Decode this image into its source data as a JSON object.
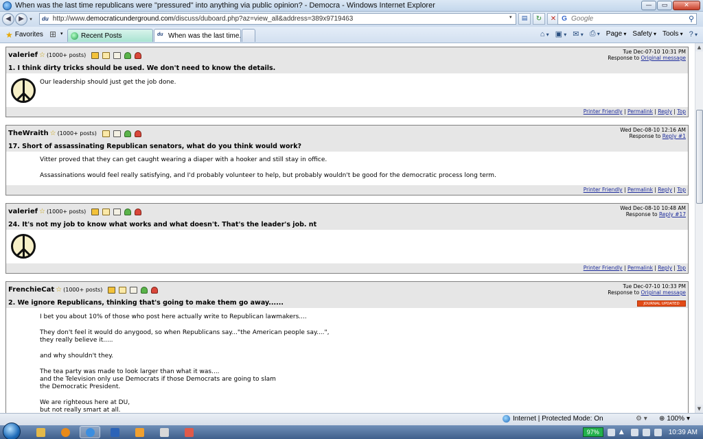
{
  "window": {
    "title": "When was the last time republicans were \"pressured\" into anything via public opinion? - Democra - Windows Internet Explorer"
  },
  "address_bar": {
    "url_prefix": "http://www.",
    "url_domain": "democraticunderground.com",
    "url_path": "/discuss/duboard.php?az=view_all&address=389x9719463"
  },
  "search": {
    "placeholder": "Google"
  },
  "favorites_bar": {
    "favorites_label": "Favorites",
    "tabs": [
      {
        "label": "Recent Posts"
      },
      {
        "label": "When was the last time..."
      }
    ]
  },
  "command_bar": {
    "page_label": "Page",
    "safety_label": "Safety",
    "tools_label": "Tools"
  },
  "posts": [
    {
      "author": "valerief",
      "post_count": "(1000+ posts)",
      "date": "Tue Dec-07-10 10:31 PM",
      "response_prefix": "Response to",
      "response_link": "Original message",
      "subject": "1. I think dirty tricks should be used. We don't need to know the details.",
      "body": [
        "Our leadership should just get the job done."
      ]
    },
    {
      "author": "TheWraith",
      "post_count": "(1000+ posts)",
      "date": "Wed Dec-08-10 12:16 AM",
      "response_prefix": "Response to",
      "response_link": "Reply #1",
      "subject": "17. Short of assassinating Republican senators, what do you think would work?",
      "body": [
        "Vitter proved that they can get caught wearing a diaper with a hooker and still stay in office.",
        "Assassinations would feel really satisfying, and I'd probably volunteer to help, but probably wouldn't be good for the democratic process long term."
      ]
    },
    {
      "author": "valerief",
      "post_count": "(1000+ posts)",
      "date": "Wed Dec-08-10 10:48 AM",
      "response_prefix": "Response to",
      "response_link": "Reply #17",
      "subject": "24. It's not my job to know what works and what doesn't. That's the leader's job. nt",
      "body": []
    },
    {
      "author": "FrenchieCat",
      "post_count": "(1000+ posts)",
      "date": "Tue Dec-07-10 10:33 PM",
      "response_prefix": "Response to",
      "response_link": "Original message",
      "subject": "2. We ignore Republicans, thinking that's going to make them go away......",
      "badge": "JOURNAL UPDATED",
      "body": [
        "I bet you about 10% of those who post here actually write to Republican lawmakers....",
        "They don't feel it would do anygood, so when Republicans say...\"the American people say....\",",
        "they really believe it.....",
        "and why shouldn't they.",
        "The tea party was made to look larger than what it was....",
        "and the Television only use Democrats if those Democrats are going to slam",
        "the Democratic President.",
        "We are righteous here at DU,",
        "but not really smart at all."
      ]
    }
  ],
  "post_footer": {
    "printer_friendly": "Printer Friendly",
    "permalink": "Permalink",
    "reply": "Reply",
    "top": "Top",
    "separator": "|"
  },
  "status_bar": {
    "zone_text": "Internet | Protected Mode: On",
    "zoom": "100%"
  },
  "taskbar": {
    "battery": "97%",
    "clock": "10:39 AM"
  }
}
